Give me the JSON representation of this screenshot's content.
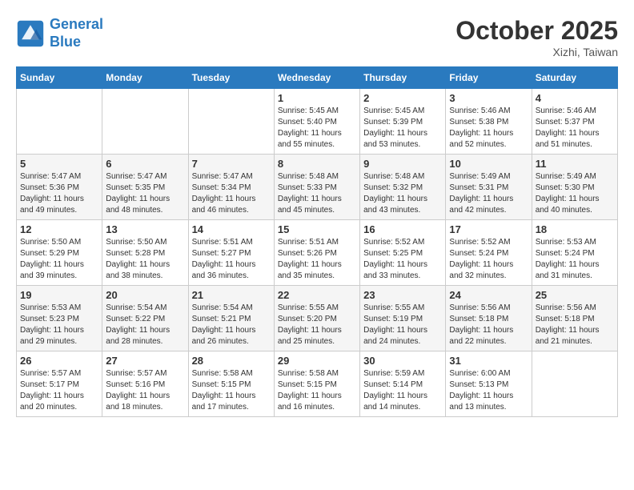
{
  "header": {
    "logo_line1": "General",
    "logo_line2": "Blue",
    "month_title": "October 2025",
    "location": "Xizhi, Taiwan"
  },
  "days_of_week": [
    "Sunday",
    "Monday",
    "Tuesday",
    "Wednesday",
    "Thursday",
    "Friday",
    "Saturday"
  ],
  "weeks": [
    [
      {
        "day": "",
        "info": ""
      },
      {
        "day": "",
        "info": ""
      },
      {
        "day": "",
        "info": ""
      },
      {
        "day": "1",
        "info": "Sunrise: 5:45 AM\nSunset: 5:40 PM\nDaylight: 11 hours\nand 55 minutes."
      },
      {
        "day": "2",
        "info": "Sunrise: 5:45 AM\nSunset: 5:39 PM\nDaylight: 11 hours\nand 53 minutes."
      },
      {
        "day": "3",
        "info": "Sunrise: 5:46 AM\nSunset: 5:38 PM\nDaylight: 11 hours\nand 52 minutes."
      },
      {
        "day": "4",
        "info": "Sunrise: 5:46 AM\nSunset: 5:37 PM\nDaylight: 11 hours\nand 51 minutes."
      }
    ],
    [
      {
        "day": "5",
        "info": "Sunrise: 5:47 AM\nSunset: 5:36 PM\nDaylight: 11 hours\nand 49 minutes."
      },
      {
        "day": "6",
        "info": "Sunrise: 5:47 AM\nSunset: 5:35 PM\nDaylight: 11 hours\nand 48 minutes."
      },
      {
        "day": "7",
        "info": "Sunrise: 5:47 AM\nSunset: 5:34 PM\nDaylight: 11 hours\nand 46 minutes."
      },
      {
        "day": "8",
        "info": "Sunrise: 5:48 AM\nSunset: 5:33 PM\nDaylight: 11 hours\nand 45 minutes."
      },
      {
        "day": "9",
        "info": "Sunrise: 5:48 AM\nSunset: 5:32 PM\nDaylight: 11 hours\nand 43 minutes."
      },
      {
        "day": "10",
        "info": "Sunrise: 5:49 AM\nSunset: 5:31 PM\nDaylight: 11 hours\nand 42 minutes."
      },
      {
        "day": "11",
        "info": "Sunrise: 5:49 AM\nSunset: 5:30 PM\nDaylight: 11 hours\nand 40 minutes."
      }
    ],
    [
      {
        "day": "12",
        "info": "Sunrise: 5:50 AM\nSunset: 5:29 PM\nDaylight: 11 hours\nand 39 minutes."
      },
      {
        "day": "13",
        "info": "Sunrise: 5:50 AM\nSunset: 5:28 PM\nDaylight: 11 hours\nand 38 minutes."
      },
      {
        "day": "14",
        "info": "Sunrise: 5:51 AM\nSunset: 5:27 PM\nDaylight: 11 hours\nand 36 minutes."
      },
      {
        "day": "15",
        "info": "Sunrise: 5:51 AM\nSunset: 5:26 PM\nDaylight: 11 hours\nand 35 minutes."
      },
      {
        "day": "16",
        "info": "Sunrise: 5:52 AM\nSunset: 5:25 PM\nDaylight: 11 hours\nand 33 minutes."
      },
      {
        "day": "17",
        "info": "Sunrise: 5:52 AM\nSunset: 5:24 PM\nDaylight: 11 hours\nand 32 minutes."
      },
      {
        "day": "18",
        "info": "Sunrise: 5:53 AM\nSunset: 5:24 PM\nDaylight: 11 hours\nand 31 minutes."
      }
    ],
    [
      {
        "day": "19",
        "info": "Sunrise: 5:53 AM\nSunset: 5:23 PM\nDaylight: 11 hours\nand 29 minutes."
      },
      {
        "day": "20",
        "info": "Sunrise: 5:54 AM\nSunset: 5:22 PM\nDaylight: 11 hours\nand 28 minutes."
      },
      {
        "day": "21",
        "info": "Sunrise: 5:54 AM\nSunset: 5:21 PM\nDaylight: 11 hours\nand 26 minutes."
      },
      {
        "day": "22",
        "info": "Sunrise: 5:55 AM\nSunset: 5:20 PM\nDaylight: 11 hours\nand 25 minutes."
      },
      {
        "day": "23",
        "info": "Sunrise: 5:55 AM\nSunset: 5:19 PM\nDaylight: 11 hours\nand 24 minutes."
      },
      {
        "day": "24",
        "info": "Sunrise: 5:56 AM\nSunset: 5:18 PM\nDaylight: 11 hours\nand 22 minutes."
      },
      {
        "day": "25",
        "info": "Sunrise: 5:56 AM\nSunset: 5:18 PM\nDaylight: 11 hours\nand 21 minutes."
      }
    ],
    [
      {
        "day": "26",
        "info": "Sunrise: 5:57 AM\nSunset: 5:17 PM\nDaylight: 11 hours\nand 20 minutes."
      },
      {
        "day": "27",
        "info": "Sunrise: 5:57 AM\nSunset: 5:16 PM\nDaylight: 11 hours\nand 18 minutes."
      },
      {
        "day": "28",
        "info": "Sunrise: 5:58 AM\nSunset: 5:15 PM\nDaylight: 11 hours\nand 17 minutes."
      },
      {
        "day": "29",
        "info": "Sunrise: 5:58 AM\nSunset: 5:15 PM\nDaylight: 11 hours\nand 16 minutes."
      },
      {
        "day": "30",
        "info": "Sunrise: 5:59 AM\nSunset: 5:14 PM\nDaylight: 11 hours\nand 14 minutes."
      },
      {
        "day": "31",
        "info": "Sunrise: 6:00 AM\nSunset: 5:13 PM\nDaylight: 11 hours\nand 13 minutes."
      },
      {
        "day": "",
        "info": ""
      }
    ]
  ]
}
